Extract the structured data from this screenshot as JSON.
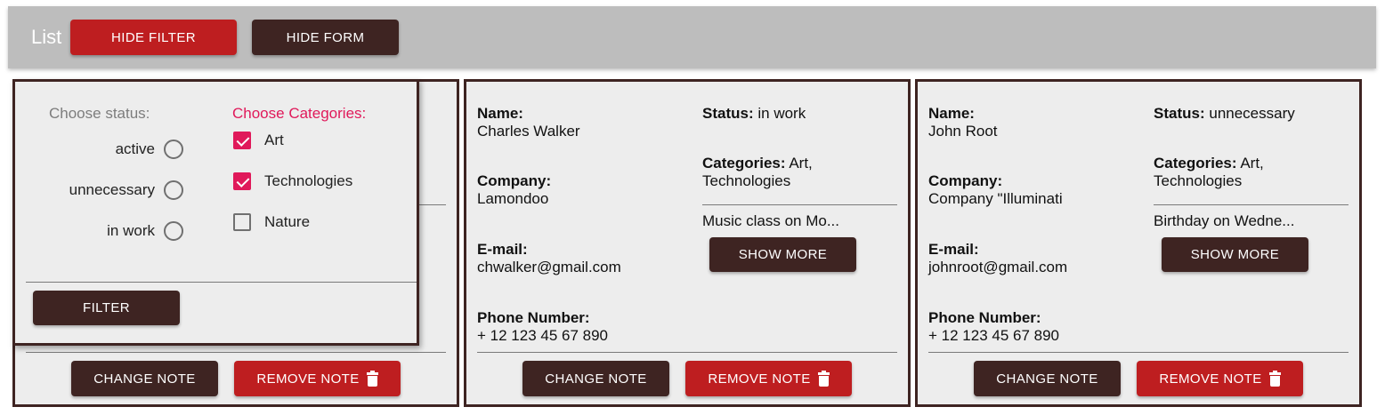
{
  "header": {
    "title": "List",
    "hide_filter_label": "HIDE FILTER",
    "hide_form_label": "HIDE FORM"
  },
  "filter": {
    "status_heading": "Choose status:",
    "statuses": [
      "active",
      "unnecessary",
      "in work"
    ],
    "categories_heading": "Choose Categories:",
    "categories": [
      {
        "label": "Art",
        "checked": true
      },
      {
        "label": "Technologies",
        "checked": true
      },
      {
        "label": "Nature",
        "checked": false
      }
    ],
    "filter_button": "FILTER"
  },
  "labels": {
    "name": "Name:",
    "company": "Company:",
    "email": "E-mail:",
    "phone": "Phone Number:",
    "status": "Status:",
    "categories": "Categories:",
    "show_more": "SHOW MORE",
    "change_note": "CHANGE NOTE",
    "remove_note": "REMOVE NOTE"
  },
  "notes": [
    {
      "name": "Charles Walker",
      "company": "Lamondoo",
      "email": "chwalker@gmail.com",
      "phone": "+ 12 123 45 67 890",
      "status": "in work",
      "categories_line1": "Art,",
      "categories_line2": "Technologies",
      "description": "Music class on Mo..."
    },
    {
      "name": "John Root",
      "company": "Company \"Illuminati",
      "email": "johnroot@gmail.com",
      "phone": "+ 12 123 45 67 890",
      "status": "unnecessary",
      "categories_line1": "Art,",
      "categories_line2": "Technologies",
      "description": "Birthday on Wedne..."
    }
  ],
  "colors": {
    "red": "#be1e20",
    "dark": "#3e2422",
    "accent": "#e0195a",
    "topbar": "#bdbdbd",
    "card": "#ededed"
  }
}
